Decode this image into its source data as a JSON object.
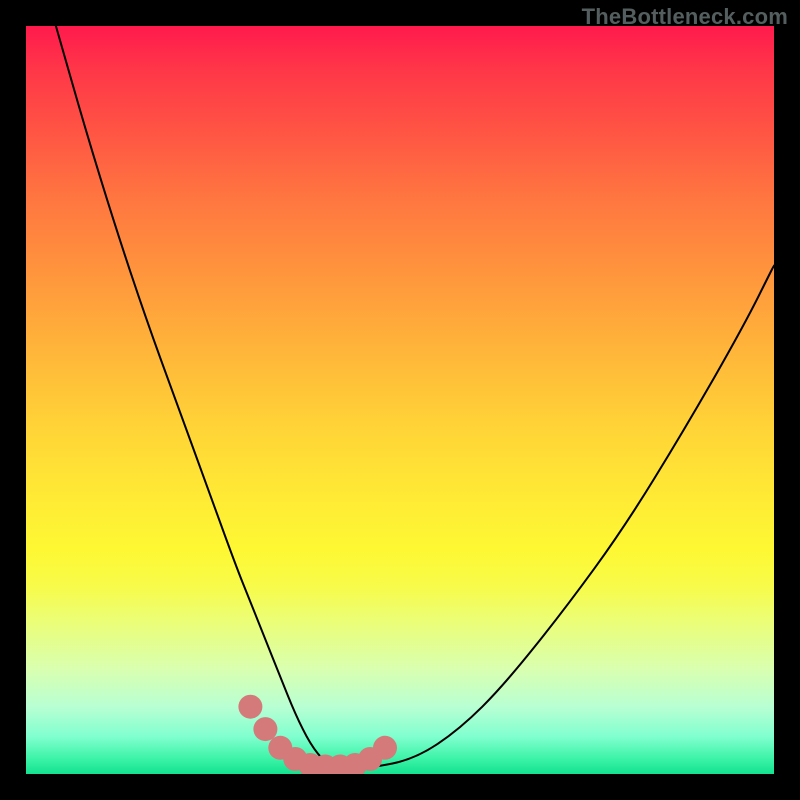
{
  "watermark": "TheBottleneck.com",
  "chart_data": {
    "type": "line",
    "title": "",
    "subtitle": "",
    "xlabel": "",
    "ylabel": "",
    "xlim": [
      0,
      100
    ],
    "ylim": [
      0,
      100
    ],
    "grid": false,
    "legend": false,
    "annotations": [],
    "series": [
      {
        "name": "bottleneck-curve",
        "color": "#000000",
        "stroke_width": 2,
        "x": [
          4,
          8,
          12,
          16,
          20,
          24,
          28,
          30,
          32,
          34,
          36,
          38,
          40,
          42,
          46,
          52,
          58,
          64,
          72,
          80,
          88,
          96,
          100
        ],
        "y": [
          100,
          86,
          73,
          61,
          50,
          39,
          28,
          23,
          18,
          13,
          8,
          4,
          1.5,
          0.8,
          0.8,
          2,
          6,
          12,
          22,
          33,
          46,
          60,
          68
        ]
      },
      {
        "name": "optimal-band-marker",
        "color": "#d47a7a",
        "type": "scatter",
        "marker_radius": 12,
        "x": [
          30,
          32,
          34,
          36,
          38,
          40,
          42,
          44,
          46,
          48
        ],
        "y": [
          9,
          6,
          3.5,
          2,
          1.2,
          1,
          1,
          1.2,
          2,
          3.5
        ]
      }
    ]
  }
}
